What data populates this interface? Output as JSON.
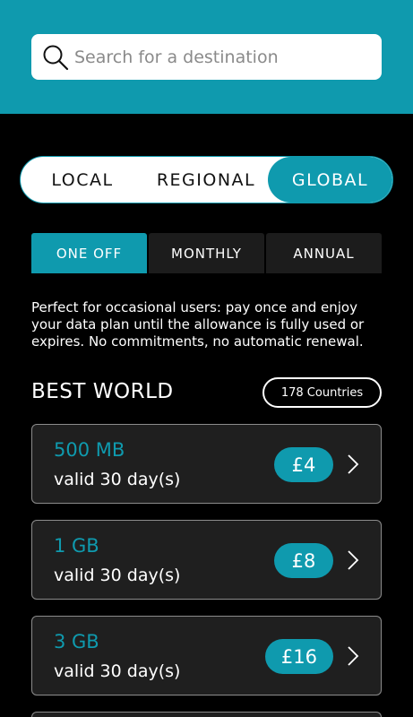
{
  "search": {
    "placeholder": "Search for a destination"
  },
  "scope_tabs": {
    "local": "LOCAL",
    "regional": "REGIONAL",
    "global": "GLOBAL",
    "selected": "GLOBAL"
  },
  "plan_tabs": {
    "one_off": "ONE OFF",
    "monthly": "MONTHLY",
    "annual": "ANNUAL",
    "selected": "ONE OFF"
  },
  "description": "Perfect for occasional users: pay once and enjoy your data plan until the allowance is fully used or expires. No commitments, no automatic renewal.",
  "section": {
    "title": "BEST WORLD",
    "countries": "178 Countries"
  },
  "plans": [
    {
      "amount": "500 MB",
      "validity": "valid 30 day(s)",
      "price": "£4"
    },
    {
      "amount": "1 GB",
      "validity": "valid 30 day(s)",
      "price": "£8"
    },
    {
      "amount": "3 GB",
      "validity": "valid 30 day(s)",
      "price": "£16"
    }
  ],
  "colors": {
    "accent": "#0f9aae",
    "background": "#000000",
    "card": "#1f1f1f"
  },
  "icons": {
    "search": "search-icon",
    "chevron": "chevron-right-icon"
  }
}
